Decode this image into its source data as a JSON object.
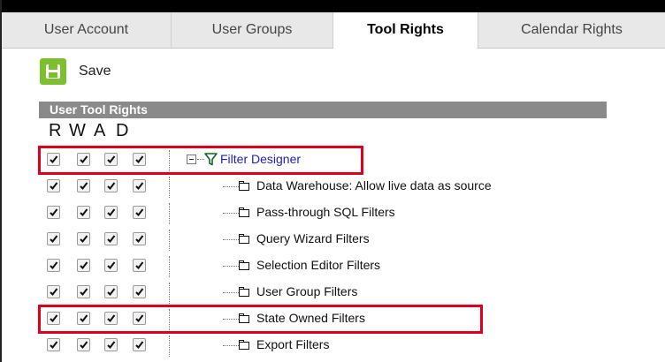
{
  "tabs": [
    {
      "label": "User Account",
      "active": false
    },
    {
      "label": "User Groups",
      "active": false
    },
    {
      "label": "Tool Rights",
      "active": true
    },
    {
      "label": "Calendar Rights",
      "active": false
    }
  ],
  "toolbar": {
    "save_label": "Save",
    "save_icon": "floppy-disk-icon"
  },
  "section": {
    "title": "User Tool Rights"
  },
  "rwad": {
    "r": "R",
    "w": "W",
    "a": "A",
    "d": "D"
  },
  "tree": {
    "root": {
      "label": "Filter Designer",
      "icon": "filter-funnel-icon",
      "checked": [
        true,
        true,
        true,
        true
      ]
    },
    "children": [
      {
        "label": "Data Warehouse: Allow live data as source",
        "checked": [
          true,
          true,
          true,
          true
        ]
      },
      {
        "label": "Pass-through SQL Filters",
        "checked": [
          true,
          true,
          true,
          true
        ]
      },
      {
        "label": "Query Wizard Filters",
        "checked": [
          true,
          true,
          true,
          true
        ]
      },
      {
        "label": "Selection Editor Filters",
        "checked": [
          true,
          true,
          true,
          true
        ]
      },
      {
        "label": "User Group Filters",
        "checked": [
          true,
          true,
          true,
          true
        ]
      },
      {
        "label": "State Owned Filters",
        "checked": [
          true,
          true,
          true,
          true
        ]
      },
      {
        "label": "Export Filters",
        "checked": [
          true,
          true,
          true,
          true
        ]
      }
    ]
  },
  "colors": {
    "highlight": "#e0001a",
    "accent": "#7cbf2f",
    "link": "#2020c8"
  }
}
